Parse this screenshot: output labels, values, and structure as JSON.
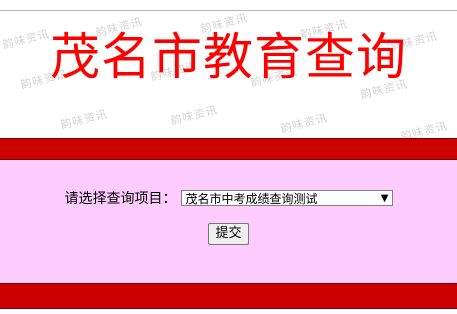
{
  "header": {
    "title": "茂名市教育查询",
    "watermark_text": "韵味资讯"
  },
  "form": {
    "label": "请选择查询项目：",
    "select_value": "茂名市中考成绩查询测试",
    "submit_label": "提交"
  },
  "colors": {
    "title": "#ff0000",
    "bar": "#cc0000",
    "panel": "#ffccff"
  }
}
